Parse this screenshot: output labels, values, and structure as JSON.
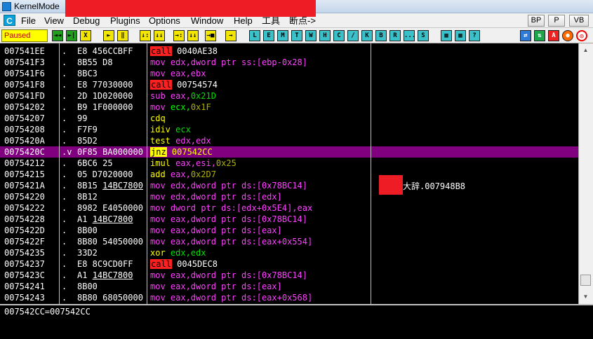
{
  "window": {
    "title": "KernelMode"
  },
  "menu": {
    "items": [
      "File",
      "View",
      "Debug",
      "Plugins",
      "Options",
      "Window",
      "Help",
      "工具",
      "断点->"
    ],
    "right_buttons": [
      "BP",
      "P",
      "VB"
    ]
  },
  "toolbar": {
    "status": "Paused",
    "buttons_a": [
      "◄◄",
      "►|",
      "X",
      "►",
      "‖",
      "↓:",
      "↓↓",
      "→:",
      "↓↓",
      "→■"
    ],
    "letters": [
      "L",
      "E",
      "M",
      "T",
      "W",
      "H",
      "C",
      "/",
      "K",
      "B",
      "R",
      "...",
      "S"
    ],
    "right_icons": [
      "grid-icon",
      "grid2-icon",
      "question-icon",
      "refresh-icon",
      "updown-icon",
      "a-icon",
      "stop-icon",
      "target-icon"
    ]
  },
  "rows": [
    {
      "addr": "007541EE",
      "mark": ".",
      "hex": "E8 456CCBFF",
      "parts": [
        [
          "call",
          "callkw"
        ],
        [
          " 0040AE38",
          "kw"
        ]
      ]
    },
    {
      "addr": "007541F3",
      "mark": ".",
      "hex": "8B55 D8",
      "parts": [
        [
          "mov edx,dword ptr ss:[ebp-0x28]",
          "mnem-m"
        ]
      ]
    },
    {
      "addr": "007541F6",
      "mark": ".",
      "hex": "8BC3",
      "parts": [
        [
          "mov ",
          "mnem-m"
        ],
        [
          "eax,ebx",
          "mnem-m"
        ]
      ]
    },
    {
      "addr": "007541F8",
      "mark": ".",
      "hex": "E8 77030000",
      "parts": [
        [
          "call",
          "callkw"
        ],
        [
          " 00754574",
          "kw"
        ]
      ]
    },
    {
      "addr": "007541FD",
      "mark": ".",
      "hex": "2D 1D020000",
      "parts": [
        [
          "sub ",
          "mnem-m"
        ],
        [
          "eax,",
          "mnem-m"
        ],
        [
          "0x21D",
          "reg"
        ]
      ]
    },
    {
      "addr": "00754202",
      "mark": ".",
      "hex": "B9 1F000000",
      "parts": [
        [
          "mov ",
          "mnem-m"
        ],
        [
          "ecx,",
          "mnem-g"
        ],
        [
          "0x1F",
          "num"
        ]
      ]
    },
    {
      "addr": "00754207",
      "mark": ".",
      "hex": "99",
      "parts": [
        [
          "cdq",
          "mnem-y"
        ]
      ]
    },
    {
      "addr": "00754208",
      "mark": ".",
      "hex": "F7F9",
      "parts": [
        [
          "idiv ",
          "mnem-y"
        ],
        [
          "ecx",
          "reg"
        ]
      ]
    },
    {
      "addr": "0075420A",
      "mark": ".",
      "hex": "85D2",
      "parts": [
        [
          "test ",
          "mnem-y"
        ],
        [
          "edx,edx",
          "mnem-m"
        ]
      ]
    },
    {
      "addr": "0075420C",
      "mark": ".v",
      "hex": "0F85 BA000000",
      "parts": [
        [
          "jnz",
          "jkw"
        ],
        [
          " 007542CC",
          "mnem-y"
        ]
      ],
      "selected": true
    },
    {
      "addr": "00754212",
      "mark": ".",
      "hex": "6BC6 25",
      "parts": [
        [
          "imul ",
          "mnem-y"
        ],
        [
          "eax,esi,",
          "mnem-m"
        ],
        [
          "0x25",
          "num"
        ]
      ]
    },
    {
      "addr": "00754215",
      "mark": ".",
      "hex": "05 D7020000",
      "parts": [
        [
          "add ",
          "mnem-y"
        ],
        [
          "eax,",
          "mnem-m"
        ],
        [
          "0x2D7",
          "num"
        ]
      ]
    },
    {
      "addr": "0075421A",
      "mark": ".",
      "hex": "8B15 14BC7800",
      "parts": [
        [
          "mov edx,dword ptr ds:[0x78BC14]",
          "mnem-m"
        ]
      ],
      "hex_u": true
    },
    {
      "addr": "00754220",
      "mark": ".",
      "hex": "8B12",
      "parts": [
        [
          "mov edx,dword ptr ds:[edx]",
          "mnem-m"
        ]
      ]
    },
    {
      "addr": "00754222",
      "mark": ".",
      "hex": "8982 E4050000",
      "parts": [
        [
          "mov dword ptr ds:[edx+0x5E4],eax",
          "mnem-m"
        ]
      ]
    },
    {
      "addr": "00754228",
      "mark": ".",
      "hex": "A1 14BC7800",
      "parts": [
        [
          "mov eax,dword ptr ds:[0x78BC14]",
          "mnem-m"
        ]
      ],
      "hex_u": true
    },
    {
      "addr": "0075422D",
      "mark": ".",
      "hex": "8B00",
      "parts": [
        [
          "mov eax,dword ptr ds:[eax]",
          "mnem-m"
        ]
      ]
    },
    {
      "addr": "0075422F",
      "mark": ".",
      "hex": "8B80 54050000",
      "parts": [
        [
          "mov eax,dword ptr ds:[eax+0x554]",
          "mnem-m"
        ]
      ]
    },
    {
      "addr": "00754235",
      "mark": ".",
      "hex": "33D2",
      "parts": [
        [
          "xor ",
          "mnem-y"
        ],
        [
          "edx,edx",
          "reg"
        ]
      ]
    },
    {
      "addr": "00754237",
      "mark": ".",
      "hex": "E8 8C9CD0FF",
      "parts": [
        [
          "call",
          "callkw"
        ],
        [
          " 0045DEC8",
          "kw"
        ]
      ]
    },
    {
      "addr": "0075423C",
      "mark": ".",
      "hex": "A1 14BC7800",
      "parts": [
        [
          "mov eax,dword ptr ds:[0x78BC14]",
          "mnem-m"
        ]
      ],
      "hex_u": true
    },
    {
      "addr": "00754241",
      "mark": ".",
      "hex": "8B00",
      "parts": [
        [
          "mov eax,dword ptr ds:[eax]",
          "mnem-m"
        ]
      ]
    },
    {
      "addr": "00754243",
      "mark": ".",
      "hex": "8B80 68050000",
      "parts": [
        [
          "mov eax,dword ptr ds:[eax+0x568]",
          "mnem-m"
        ]
      ]
    }
  ],
  "comment": "大辞.007948B8",
  "info": "007542CC=007542CC"
}
